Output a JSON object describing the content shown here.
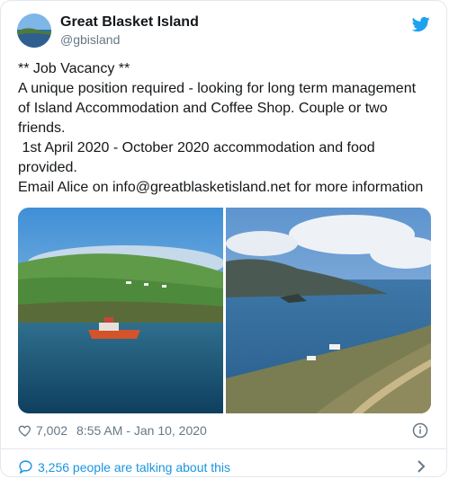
{
  "tweet": {
    "author": {
      "name": "Great Blasket Island",
      "handle": "@gbisland"
    },
    "text_lines": [
      "** Job Vacancy **",
      "A unique position required - looking for long term management",
      "of Island Accommodation and Coffee Shop. Couple or two",
      "friends.",
      " 1st April 2020 - October 2020 accommodation and food",
      "provided.",
      "Email Alice on info@greatblasketisland.net for more information"
    ],
    "likes": "7,002",
    "timestamp": "8:55 AM - Jan 10, 2020",
    "talking": "3,256 people are talking about this"
  },
  "colors": {
    "accent": "#1da1f2",
    "link": "#1b95e0",
    "muted": "#657786",
    "text": "#14171a",
    "border": "#e1e8ed"
  },
  "icons": {
    "brand": "twitter-bird-icon",
    "like": "heart-icon",
    "info": "info-icon",
    "reply": "speech-bubble-icon",
    "more": "chevron-right-icon"
  }
}
